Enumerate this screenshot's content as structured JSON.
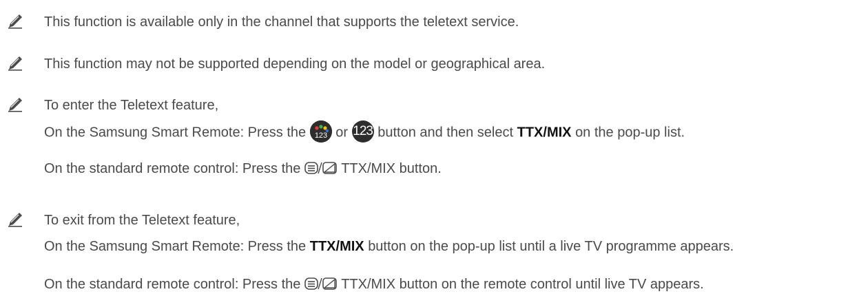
{
  "notes": [
    {
      "icon": "pencil-icon",
      "lines": [
        "This function is available only in the channel that supports the teletext service."
      ]
    },
    {
      "icon": "pencil-icon",
      "lines": [
        "This function may not be supported depending on the model or geographical area."
      ]
    },
    {
      "icon": "pencil-icon",
      "title": "To enter the Teletext feature,",
      "smart_prefix": "On the Samsung Smart Remote: Press the",
      "smart_or": "or",
      "smart_mid": "button and then select",
      "smart_bold": "TTX/MIX",
      "smart_suffix": "on the pop-up list.",
      "button_123_label": "123",
      "std_prefix": "On the standard remote control: Press the",
      "std_suffix": "TTX/MIX button."
    },
    {
      "icon": "pencil-icon",
      "title": "To exit from the Teletext feature,",
      "smart_prefix": "On the Samsung Smart Remote: Press the",
      "smart_bold": "TTX/MIX",
      "smart_suffix": "button on the pop-up list until a live TV programme appears.",
      "std_prefix": "On the standard remote control: Press the",
      "std_suffix": "TTX/MIX button on the remote control until live TV appears."
    }
  ],
  "colors": {
    "text": "#4a4a4a",
    "bold_text": "#111111",
    "button_bg": "#2d2d2d",
    "dot_red": "#e23b3b",
    "dot_green": "#3cb44b",
    "dot_yellow": "#f2c300",
    "dot_blue": "#2f6fe0"
  }
}
